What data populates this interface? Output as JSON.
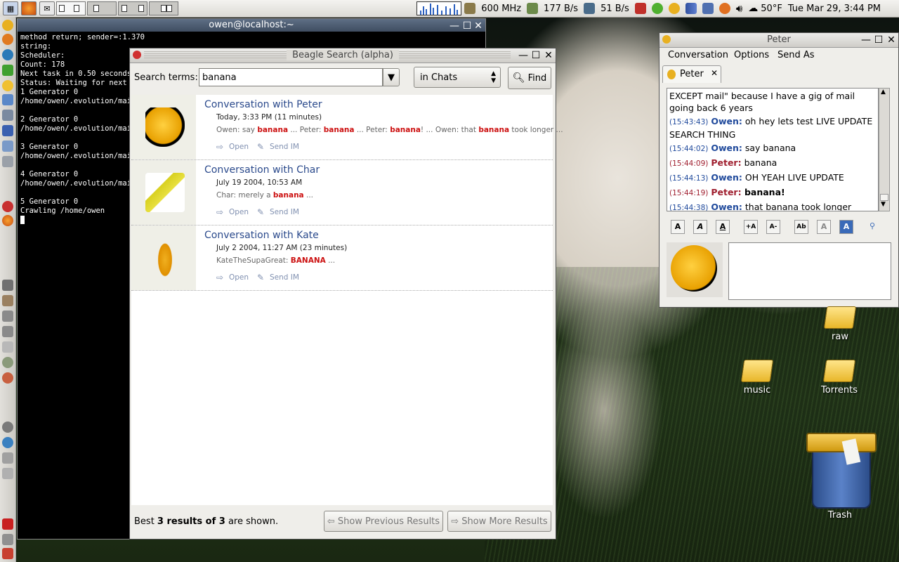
{
  "top_panel": {
    "cpu_freq": "600 MHz",
    "down_rate": "177 B/s",
    "up_rate": "51 B/s",
    "weather": "50°F",
    "clock": "Tue Mar 29,  3:44 PM"
  },
  "terminal": {
    "title": "owen@localhost:~",
    "lines": [
      "method return; sender=:1.370",
      "string:",
      "Scheduler:",
      "Count: 178",
      "Next task in 0.50 seconds",
      "Status: Waiting for next t",
      "1 Generator 0",
      "/home/owen/.evolution/mail",
      "",
      "2 Generator 0",
      "/home/owen/.evolution/mail",
      "",
      "3 Generator 0",
      "/home/owen/.evolution/mail",
      "",
      "4 Generator 0",
      "/home/owen/.evolution/mail",
      "",
      "5 Generator 0",
      "Crawling /home/owen"
    ]
  },
  "beagle": {
    "title": "Beagle Search (alpha)",
    "search_label": "Search terms:",
    "search_value": "banana",
    "scope": "in Chats",
    "find_label": "Find",
    "results": [
      {
        "title": "Conversation with Peter",
        "date": "Today, 3:33 PM (11 minutes)",
        "snippet": [
          {
            "t": "Owen: say "
          },
          {
            "t": "banana",
            "hl": true
          },
          {
            "t": " ... Peter: "
          },
          {
            "t": "banana",
            "hl": true
          },
          {
            "t": " ... Peter: "
          },
          {
            "t": "banana",
            "hl": true
          },
          {
            "t": "! ... Owen: that "
          },
          {
            "t": "banana",
            "hl": true
          },
          {
            "t": " took longer ..."
          }
        ],
        "open_label": "Open",
        "sendim_label": "Send IM"
      },
      {
        "title": "Conversation with Char",
        "date": "July 19 2004, 10:53 AM",
        "snippet": [
          {
            "t": "Char: merely a "
          },
          {
            "t": "banana",
            "hl": true
          },
          {
            "t": " ..."
          }
        ],
        "open_label": "Open",
        "sendim_label": "Send IM"
      },
      {
        "title": "Conversation with Kate",
        "date": "July 2 2004, 11:27 AM (23 minutes)",
        "snippet": [
          {
            "t": "KateTheSupaGreat: "
          },
          {
            "t": "BANANA",
            "hl": true
          },
          {
            "t": " ..."
          }
        ],
        "open_label": "Open",
        "sendim_label": "Send IM"
      }
    ],
    "status_prefix": "Best ",
    "status_bold": "3 results of 3",
    "status_suffix": " are shown.",
    "prev_label": "Show Previous Results",
    "more_label": "Show More Results"
  },
  "chat": {
    "title": "Peter",
    "menu": [
      "Conversation",
      "Options",
      "Send As"
    ],
    "tab_label": "Peter",
    "log": [
      {
        "text": "EXCEPT mail\" because I have a gig of mail going back 6 years"
      },
      {
        "ts": "(15:43:43)",
        "who": "Owen:",
        "self": true,
        "text": " oh hey lets test LIVE UPDATE SEARCH THING"
      },
      {
        "ts": "(15:44:02)",
        "who": "Owen:",
        "self": true,
        "text": " say banana"
      },
      {
        "ts": "(15:44:09)",
        "who": "Peter:",
        "self": false,
        "text": " banana"
      },
      {
        "ts": "(15:44:13)",
        "who": "Owen:",
        "self": true,
        "text": " OH YEAH LIVE UPDATE"
      },
      {
        "ts": "(15:44:19)",
        "who": "Peter:",
        "self": false,
        "text": " banana!"
      },
      {
        "ts": "(15:44:38)",
        "who": "Owen:",
        "self": true,
        "text": " that banana took longer"
      }
    ]
  },
  "desktop_icons": {
    "raw": "raw",
    "music": "music",
    "torrents": "Torrents",
    "trash": "Trash"
  },
  "icons": [
    "firefox-icon",
    "mail-icon",
    "cpu-icon",
    "network-icon",
    "volume-icon",
    "weather-icon",
    "beagle-icon",
    "close-icon",
    "maximize-icon",
    "minimize-icon",
    "search-icon",
    "open-arrow-icon",
    "send-im-icon",
    "buddy-icon"
  ]
}
